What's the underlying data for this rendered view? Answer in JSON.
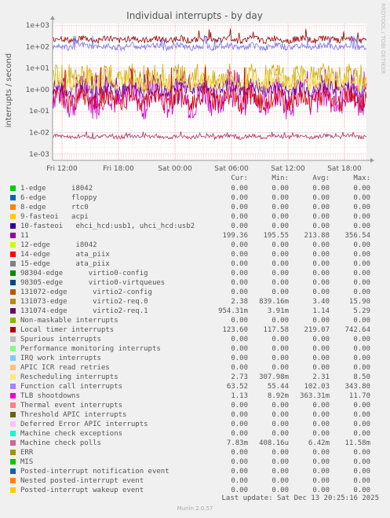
{
  "chart_data": {
    "type": "line",
    "title": "Individual interrupts - by day",
    "ylabel": "interrupts / second",
    "yscale": "log",
    "ylim": [
      0.0005,
      1200
    ],
    "y_ticks": [
      "1e-03",
      "1e-02",
      "1e-01",
      "1e+00",
      "1e+01",
      "1e+02",
      "1e+03"
    ],
    "x_ticks": [
      "Fri 12:00",
      "Fri 18:00",
      "Sat 00:00",
      "Sat 06:00",
      "Sat 12:00",
      "Sat 18:00"
    ],
    "grid": true,
    "series": [
      {
        "name": "11",
        "color": "#cc00cc",
        "base": 0.45,
        "amp": 1.3,
        "min": 0.02,
        "max": 10
      },
      {
        "name": "131073-edge      virtio2-req.0",
        "color": "#ccaa00",
        "base": 3.4,
        "amp": 0.9,
        "min": 0.839,
        "max": 15.9
      },
      {
        "name": "131074-edge      virtio2-req.1",
        "color": "#660099",
        "base": 1.14,
        "amp": 0.6,
        "min": 0.00391,
        "max": 5.29
      },
      {
        "name": "Local timer interrupts",
        "color": "#990000",
        "base": 219,
        "amp": 0.25,
        "min": 117.58,
        "max": 742.64
      },
      {
        "name": "Function call interrupts",
        "color": "#7777ee",
        "base": 102,
        "amp": 0.25,
        "min": 55.44,
        "max": 343.8
      },
      {
        "name": "Rescheduling interrupts",
        "color": "#ffdd55",
        "base": 2.31,
        "amp": 0.6,
        "min": 0.308,
        "max": 8.5
      },
      {
        "name": "TLB shootdowns",
        "color": "#cc0000",
        "base": 0.36,
        "amp": 0.8,
        "min": 0.0089,
        "max": 11.7
      },
      {
        "name": "Machine check polls",
        "color": "#aa3366",
        "base": 0.0064,
        "amp": 0.15,
        "min": 0.0004,
        "max": 0.0116
      }
    ]
  },
  "side_label": "RRDTOOL / TOBI OETIKER",
  "legend_header": {
    "cur": "Cur:",
    "min": "Min:",
    "avg": "Avg:",
    "max": "Max:"
  },
  "legend": [
    {
      "label": "1-edge      i8042",
      "color": "#00cc00",
      "cur": "0.00",
      "min": "0.00",
      "avg": "0.00",
      "max": "0.00"
    },
    {
      "label": "6-edge      floppy",
      "color": "#0066b3",
      "cur": "0.00",
      "min": "0.00",
      "avg": "0.00",
      "max": "0.00"
    },
    {
      "label": "8-edge      rtc0",
      "color": "#ff8000",
      "cur": "0.00",
      "min": "0.00",
      "avg": "0.00",
      "max": "0.00"
    },
    {
      "label": "9-fasteoi   acpi",
      "color": "#ffcc00",
      "cur": "0.00",
      "min": "0.00",
      "avg": "0.00",
      "max": "0.00"
    },
    {
      "label": "10-fasteoi   ehci_hcd:usb1, uhci_hcd:usb2",
      "color": "#330099",
      "cur": "0.00",
      "min": "0.00",
      "avg": "0.00",
      "max": "0.00"
    },
    {
      "label": "11",
      "color": "#990099",
      "cur": "199.36",
      "min": "195.55",
      "avg": "213.88",
      "max": "356.54"
    },
    {
      "label": "12-edge      i8042",
      "color": "#ccff00",
      "cur": "0.00",
      "min": "0.00",
      "avg": "0.00",
      "max": "0.00"
    },
    {
      "label": "14-edge      ata_piix",
      "color": "#ff0000",
      "cur": "0.00",
      "min": "0.00",
      "avg": "0.00",
      "max": "0.00"
    },
    {
      "label": "15-edge      ata_piix",
      "color": "#808080",
      "cur": "0.00",
      "min": "0.00",
      "avg": "0.00",
      "max": "0.00"
    },
    {
      "label": "98304-edge      virtio0-config",
      "color": "#008f00",
      "cur": "0.00",
      "min": "0.00",
      "avg": "0.00",
      "max": "0.00"
    },
    {
      "label": "98305-edge      virtio0-virtqueues",
      "color": "#00487d",
      "cur": "0.00",
      "min": "0.00",
      "avg": "0.00",
      "max": "0.00"
    },
    {
      "label": "131072-edge      virtio2-config",
      "color": "#b35a00",
      "cur": "0.00",
      "min": "0.00",
      "avg": "0.00",
      "max": "0.00"
    },
    {
      "label": "131073-edge      virtio2-req.0",
      "color": "#b38f00",
      "cur": "2.38",
      "min": "839.16m",
      "avg": "3.40",
      "max": "15.90"
    },
    {
      "label": "131074-edge      virtio2-req.1",
      "color": "#6b006b",
      "cur": "954.31m",
      "min": "3.91m",
      "avg": "1.14",
      "max": "5.29"
    },
    {
      "label": "Non-maskable interrupts",
      "color": "#8fb300",
      "cur": "0.00",
      "min": "0.00",
      "avg": "0.00",
      "max": "0.00"
    },
    {
      "label": "Local timer interrupts",
      "color": "#b30000",
      "cur": "123.60",
      "min": "117.58",
      "avg": "219.07",
      "max": "742.64"
    },
    {
      "label": "Spurious interrupts",
      "color": "#bebebe",
      "cur": "0.00",
      "min": "0.00",
      "avg": "0.00",
      "max": "0.00"
    },
    {
      "label": "Performance monitoring interrupts",
      "color": "#80ff80",
      "cur": "0.00",
      "min": "0.00",
      "avg": "0.00",
      "max": "0.00"
    },
    {
      "label": "IRQ work interrupts",
      "color": "#80c9ff",
      "cur": "0.00",
      "min": "0.00",
      "avg": "0.00",
      "max": "0.00"
    },
    {
      "label": "APIC ICR read retries",
      "color": "#ffc080",
      "cur": "0.00",
      "min": "0.00",
      "avg": "0.00",
      "max": "0.00"
    },
    {
      "label": "Rescheduling interrupts",
      "color": "#ffe680",
      "cur": "2.73",
      "min": "307.98m",
      "avg": "2.31",
      "max": "8.50"
    },
    {
      "label": "Function call interrupts",
      "color": "#aa80ff",
      "cur": "63.52",
      "min": "55.44",
      "avg": "102.03",
      "max": "343.80"
    },
    {
      "label": "TLB shootdowns",
      "color": "#ee00cc",
      "cur": "1.13",
      "min": "8.92m",
      "avg": "363.31m",
      "max": "11.70"
    },
    {
      "label": "Thermal event interrupts",
      "color": "#ff8080",
      "cur": "0.00",
      "min": "0.00",
      "avg": "0.00",
      "max": "0.00"
    },
    {
      "label": "Threshold APIC interrupts",
      "color": "#666600",
      "cur": "0.00",
      "min": "0.00",
      "avg": "0.00",
      "max": "0.00"
    },
    {
      "label": "Deferred Error APIC interrupts",
      "color": "#ffbfff",
      "cur": "0.00",
      "min": "0.00",
      "avg": "0.00",
      "max": "0.00"
    },
    {
      "label": "Machine check exceptions",
      "color": "#00ffcc",
      "cur": "0.00",
      "min": "0.00",
      "avg": "0.00",
      "max": "0.00"
    },
    {
      "label": "Machine check polls",
      "color": "#cc6699",
      "cur": "7.83m",
      "min": "408.16u",
      "avg": "6.42m",
      "max": "11.58m"
    },
    {
      "label": "ERR",
      "color": "#999900",
      "cur": "0.00",
      "min": "0.00",
      "avg": "0.00",
      "max": "0.00"
    },
    {
      "label": "MIS",
      "color": "#00cc00",
      "cur": "0.00",
      "min": "0.00",
      "avg": "0.00",
      "max": "0.00"
    },
    {
      "label": "Posted-interrupt notification event",
      "color": "#0066b3",
      "cur": "0.00",
      "min": "0.00",
      "avg": "0.00",
      "max": "0.00"
    },
    {
      "label": "Nested posted-interrupt event",
      "color": "#ff8000",
      "cur": "0.00",
      "min": "0.00",
      "avg": "0.00",
      "max": "0.00"
    },
    {
      "label": "Posted-interrupt wakeup event",
      "color": "#ffcc00",
      "cur": "0.00",
      "min": "0.00",
      "avg": "0.00",
      "max": "0.00"
    }
  ],
  "last_update": "Last update: Sat Dec 13 20:25:16 2025",
  "footer": "Munin 2.0.57"
}
